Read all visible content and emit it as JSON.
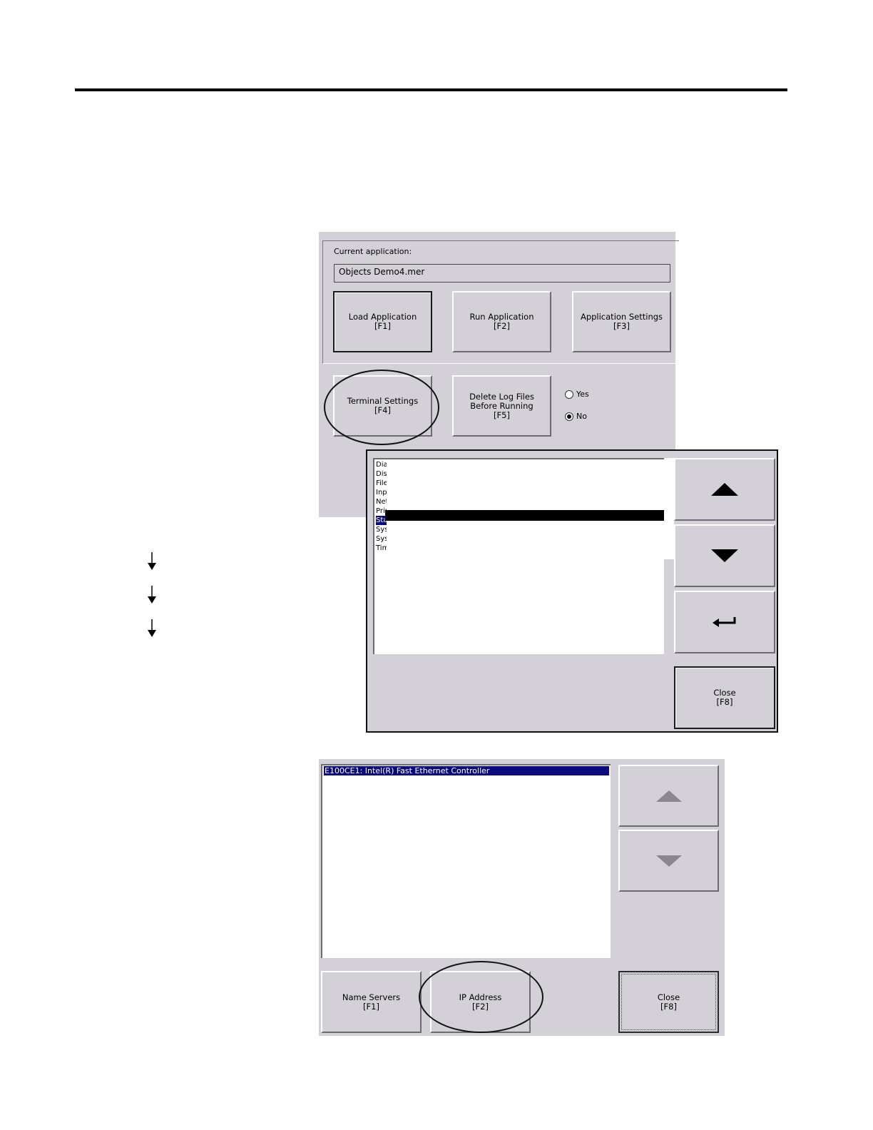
{
  "screen_main": {
    "current_application_label": "Current application:",
    "current_application_value": "Objects Demo4.mer",
    "buttons": {
      "load": "Load Application\n[F1]",
      "run": "Run Application\n[F2]",
      "app_settings": "Application Settings\n[F3]",
      "terminal_settings": "Terminal Settings\n[F4]",
      "delete_log": "Delete Log Files\nBefore Running\n[F5]"
    },
    "radio": {
      "yes_label": "Yes",
      "no_label": "No",
      "selected": "No"
    }
  },
  "screen_terminal": {
    "items": [
      "Dia",
      "Dis",
      "File",
      "Inp",
      "Net",
      "Prin",
      "Sta",
      "Sys",
      "Sys",
      "Tim"
    ],
    "selected_index": 6,
    "buttons": {
      "close": "Close\n[F8]"
    },
    "icons": [
      "up-arrow-icon",
      "down-arrow-icon",
      "enter-icon"
    ]
  },
  "screen_network": {
    "selected_item": "E100CE1: Intel(R) Fast Ethernet Controller",
    "buttons": {
      "name_servers": "Name Servers\n[F1]",
      "ip_address": "IP Address\n[F2]",
      "close": "Close\n[F8]"
    },
    "icons": [
      "up-arrow-icon",
      "down-arrow-icon"
    ]
  }
}
